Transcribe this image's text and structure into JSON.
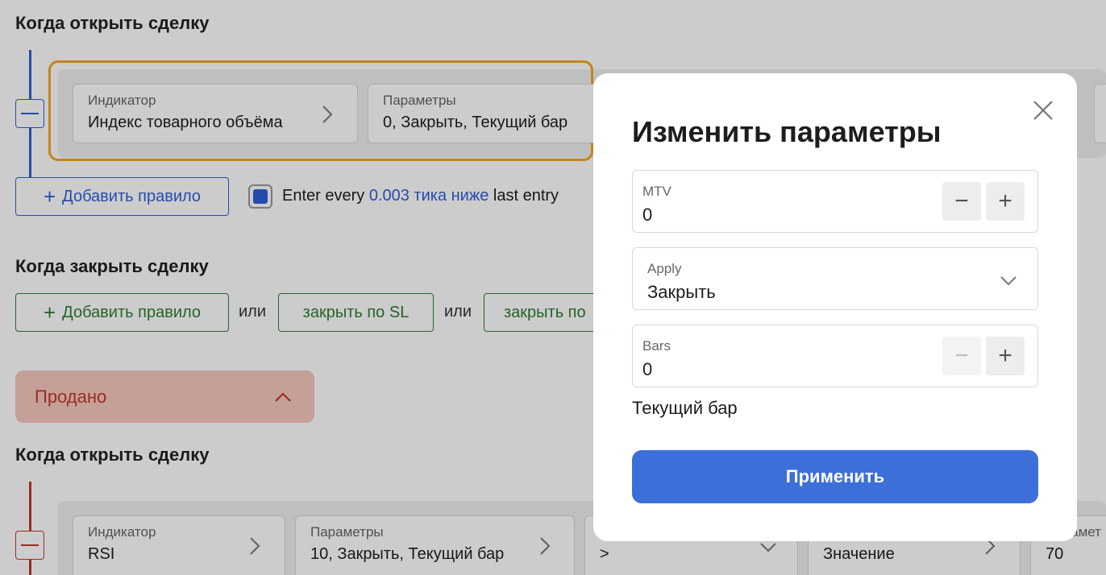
{
  "buy_section": {
    "open_title": "Когда открыть сделку",
    "rule": {
      "indicator_label": "Индикатор",
      "indicator_value": "Индекс товарного объёма",
      "params_label": "Параметры",
      "params_value": "0, Закрыть, Текущий бар"
    },
    "add_rule_label": "Добавить правило",
    "entry_text": {
      "prefix": "Enter every ",
      "link": "0.003 тика ниже",
      "suffix": " last entry"
    },
    "close_title": "Когда закрыть сделку",
    "close_add_rule_label": "Добавить правило",
    "or_label": "или",
    "close_sl_label": "закрыть по SL",
    "close_tp_label": "закрыть по"
  },
  "sold_section": {
    "header": "Продано",
    "open_title": "Когда открыть сделку",
    "rule": {
      "indicator_label": "Индикатор",
      "indicator_value": "RSI",
      "params_label": "Параметры",
      "params_value": "10, Закрыть, Текущий бар",
      "compare_value": ">",
      "target_value": "Значение",
      "extra_label": "Парамет",
      "extra_value": "70"
    }
  },
  "modal": {
    "title": "Изменить параметры",
    "fields": [
      {
        "label": "MTV",
        "value": "0"
      },
      {
        "label": "Apply",
        "value": "Закрыть"
      },
      {
        "label": "Bars",
        "value": "0"
      }
    ],
    "note": "Текущий бар",
    "apply_label": "Применить"
  },
  "colors": {
    "accent_blue": "#3d6fd9",
    "highlight_orange": "#f5a623",
    "sold_red": "#c0392b",
    "close_green": "#2e7d32"
  }
}
